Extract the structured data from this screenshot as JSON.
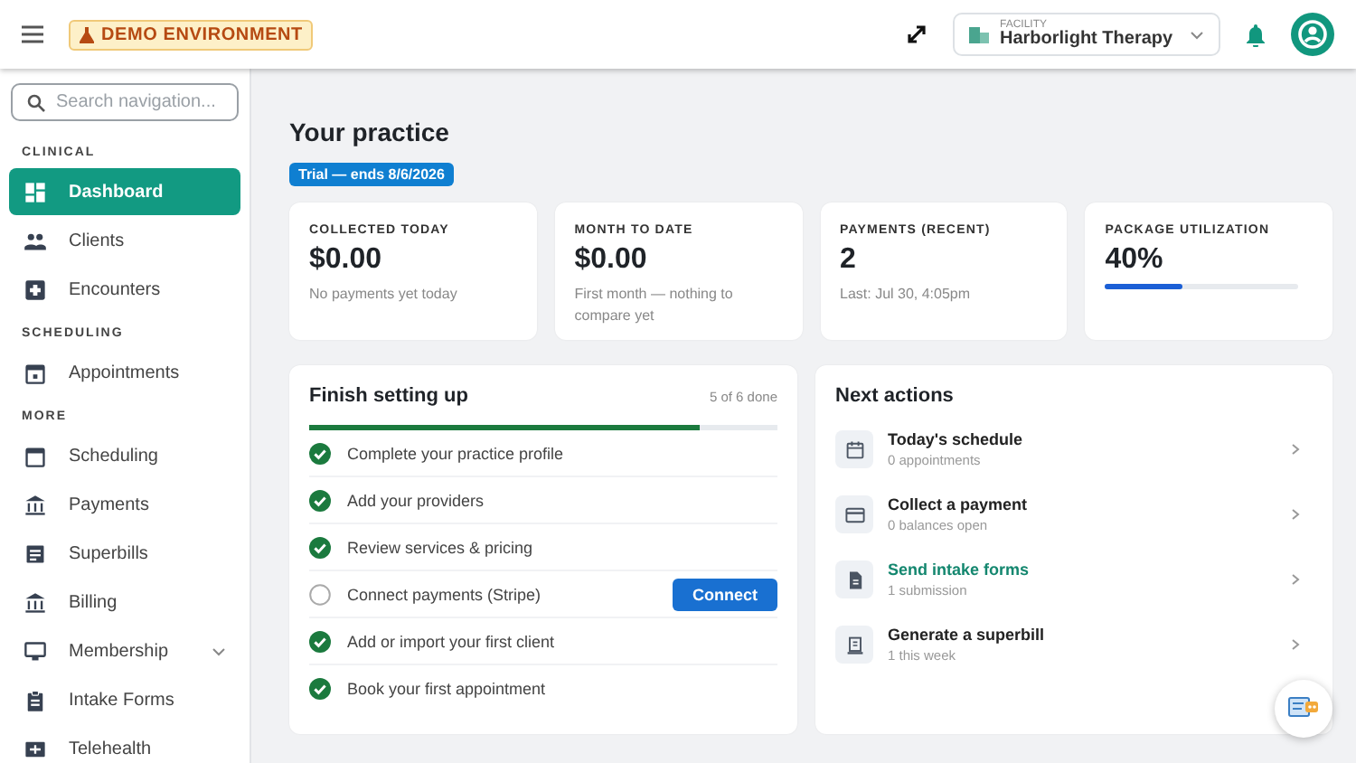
{
  "topbar": {
    "badge": "DEMO ENVIRONMENT",
    "facility": {
      "label": "FACILITY",
      "name": "Harborlight Therapy"
    }
  },
  "sidebar": {
    "search": {
      "placeholder": "Search navigation..."
    },
    "items": [
      {
        "kind": "section",
        "label": "CLINICAL"
      },
      {
        "kind": "item",
        "label": "Dashboard",
        "selected": true
      },
      {
        "kind": "item",
        "label": "Clients",
        "selected": false
      },
      {
        "kind": "item",
        "label": "Encounters",
        "selected": false
      },
      {
        "kind": "section",
        "label": "SCHEDULING"
      },
      {
        "kind": "item",
        "label": "Appointments",
        "selected": false
      },
      {
        "kind": "section",
        "label": "MORE"
      },
      {
        "kind": "item",
        "label": "Scheduling",
        "selected": false
      },
      {
        "kind": "item",
        "label": "Payments",
        "selected": false
      },
      {
        "kind": "item",
        "label": "Superbills",
        "selected": false
      },
      {
        "kind": "item",
        "label": "Billing",
        "selected": false
      },
      {
        "kind": "item",
        "label": "Membership",
        "selected": false,
        "expandable": true
      },
      {
        "kind": "item",
        "label": "Intake Forms",
        "selected": false
      },
      {
        "kind": "item",
        "label": "Telehealth",
        "selected": false
      }
    ]
  },
  "page": {
    "title": "Your practice",
    "trial": "Trial — ends 8/6/2026"
  },
  "stats": [
    {
      "label": "COLLECTED TODAY",
      "value": "$0.00",
      "note": "No payments yet today"
    },
    {
      "label": "MONTH TO DATE",
      "value": "$0.00",
      "note": "First month — nothing to compare yet"
    },
    {
      "label": "PAYMENTS (RECENT)",
      "value": "2",
      "note": "Last: Jul 30, 4:05pm"
    },
    {
      "label": "PACKAGE UTILIZATION",
      "value": "40%",
      "level": 0.4
    }
  ],
  "setup": {
    "title": "Finish setting up",
    "count": "5 of 6 done",
    "level": 0.833,
    "tasks": [
      {
        "label": "Complete your practice profile",
        "checked": true
      },
      {
        "label": "Add your providers",
        "checked": true
      },
      {
        "label": "Review services & pricing",
        "checked": true
      },
      {
        "label": "Connect payments (Stripe)",
        "checked": false,
        "action": "Connect"
      },
      {
        "label": "Add or import your first client",
        "checked": true
      },
      {
        "label": "Book your first appointment",
        "checked": true
      }
    ]
  },
  "next_actions": {
    "title": "Next actions",
    "items": [
      {
        "title": "Today's schedule",
        "subtitle": "0 appointments",
        "selected": false
      },
      {
        "title": "Collect a payment",
        "subtitle": "0 balances open",
        "selected": false
      },
      {
        "title": "Send intake forms",
        "subtitle": "1 submission",
        "selected": true
      },
      {
        "title": "Generate a superbill",
        "subtitle": "1 this week",
        "selected": false
      }
    ]
  }
}
